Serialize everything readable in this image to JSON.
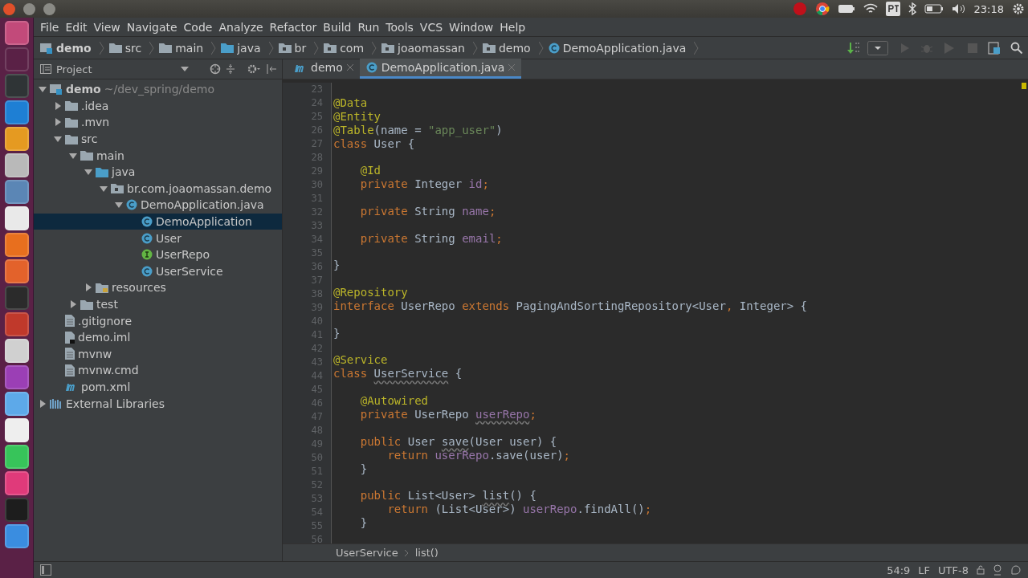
{
  "top_panel": {
    "clock": "23:18"
  },
  "menu": [
    "File",
    "Edit",
    "View",
    "Navigate",
    "Code",
    "Analyze",
    "Refactor",
    "Build",
    "Run",
    "Tools",
    "VCS",
    "Window",
    "Help"
  ],
  "nav_path": [
    {
      "label": "demo",
      "kind": "module"
    },
    {
      "label": "src",
      "kind": "folder"
    },
    {
      "label": "main",
      "kind": "folder"
    },
    {
      "label": "java",
      "kind": "source"
    },
    {
      "label": "br",
      "kind": "package"
    },
    {
      "label": "com",
      "kind": "package"
    },
    {
      "label": "joaomassan",
      "kind": "package"
    },
    {
      "label": "demo",
      "kind": "package"
    },
    {
      "label": "DemoApplication.java",
      "kind": "class"
    }
  ],
  "project_panel": {
    "title": "Project",
    "tree": [
      {
        "label": "demo",
        "hint": "~/dev_spring/demo",
        "kind": "module",
        "expanded": true,
        "selected": false,
        "children": [
          {
            "label": ".idea",
            "kind": "folder",
            "expanded": false,
            "selected": false
          },
          {
            "label": ".mvn",
            "kind": "folder",
            "expanded": false,
            "selected": false
          },
          {
            "label": "src",
            "kind": "folder",
            "expanded": true,
            "selected": false,
            "children": [
              {
                "label": "main",
                "kind": "folder",
                "expanded": true,
                "selected": false,
                "children": [
                  {
                    "label": "java",
                    "kind": "source",
                    "expanded": true,
                    "selected": false,
                    "children": [
                      {
                        "label": "br.com.joaomassan.demo",
                        "kind": "package",
                        "expanded": true,
                        "selected": false,
                        "children": [
                          {
                            "label": "DemoApplication.java",
                            "kind": "class",
                            "expanded": true,
                            "selected": false,
                            "children": [
                              {
                                "label": "DemoApplication",
                                "kind": "class",
                                "selected": true
                              },
                              {
                                "label": "User",
                                "kind": "class",
                                "selected": false
                              },
                              {
                                "label": "UserRepo",
                                "kind": "interface",
                                "selected": false
                              },
                              {
                                "label": "UserService",
                                "kind": "class",
                                "selected": false
                              }
                            ]
                          }
                        ]
                      }
                    ]
                  },
                  {
                    "label": "resources",
                    "kind": "resources",
                    "expanded": false,
                    "selected": false
                  }
                ]
              },
              {
                "label": "test",
                "kind": "folder",
                "expanded": false,
                "selected": false
              }
            ]
          },
          {
            "label": ".gitignore",
            "kind": "file",
            "selected": false
          },
          {
            "label": "demo.iml",
            "kind": "iml",
            "selected": false
          },
          {
            "label": "mvnw",
            "kind": "file",
            "selected": false
          },
          {
            "label": "mvnw.cmd",
            "kind": "file",
            "selected": false
          },
          {
            "label": "pom.xml",
            "kind": "maven",
            "selected": false
          }
        ]
      },
      {
        "label": "External Libraries",
        "kind": "libraries",
        "expanded": false,
        "selected": false
      }
    ]
  },
  "tabs": [
    {
      "label": "demo",
      "kind": "maven",
      "selected": false
    },
    {
      "label": "DemoApplication.java",
      "kind": "class",
      "selected": true
    }
  ],
  "code": [
    {
      "number": "23"
    },
    {
      "number": "24",
      "segments": [
        {
          "kind": "annotation",
          "text": "@Data"
        }
      ]
    },
    {
      "number": "25",
      "segments": [
        {
          "kind": "annotation",
          "text": "@Entity"
        }
      ]
    },
    {
      "number": "26",
      "segments": [
        {
          "kind": "annotation",
          "text": "@Table"
        },
        {
          "kind": "plain",
          "text": "(name = "
        },
        {
          "kind": "string",
          "text": "\"app_user\""
        },
        {
          "kind": "plain",
          "text": ")"
        }
      ]
    },
    {
      "number": "27",
      "segments": [
        {
          "kind": "keyword",
          "text": "class "
        },
        {
          "kind": "plain",
          "text": "User {"
        }
      ]
    },
    {
      "number": "28"
    },
    {
      "number": "29",
      "segments": [
        {
          "kind": "annotation",
          "text": "    @Id"
        }
      ]
    },
    {
      "number": "30",
      "segments": [
        {
          "kind": "keyword",
          "text": "    private "
        },
        {
          "kind": "plain",
          "text": "Integer "
        },
        {
          "kind": "field",
          "text": "id"
        },
        {
          "kind": "keyword",
          "text": ";"
        }
      ]
    },
    {
      "number": "31"
    },
    {
      "number": "32",
      "segments": [
        {
          "kind": "keyword",
          "text": "    private "
        },
        {
          "kind": "plain",
          "text": "String "
        },
        {
          "kind": "field",
          "text": "name"
        },
        {
          "kind": "keyword",
          "text": ";"
        }
      ]
    },
    {
      "number": "33"
    },
    {
      "number": "34",
      "segments": [
        {
          "kind": "keyword",
          "text": "    private "
        },
        {
          "kind": "plain",
          "text": "String "
        },
        {
          "kind": "field",
          "text": "email"
        },
        {
          "kind": "keyword",
          "text": ";"
        }
      ]
    },
    {
      "number": "35"
    },
    {
      "number": "36",
      "segments": [
        {
          "kind": "plain",
          "text": "}"
        }
      ]
    },
    {
      "number": "37"
    },
    {
      "number": "38",
      "segments": [
        {
          "kind": "annotation",
          "text": "@Repository"
        }
      ]
    },
    {
      "number": "39",
      "segments": [
        {
          "kind": "keyword",
          "text": "interface "
        },
        {
          "kind": "plain",
          "text": "UserRepo "
        },
        {
          "kind": "keyword",
          "text": "extends "
        },
        {
          "kind": "plain",
          "text": "PagingAndSortingRepository<User"
        },
        {
          "kind": "keyword",
          "text": ", "
        },
        {
          "kind": "plain",
          "text": "Integer> {"
        }
      ]
    },
    {
      "number": "40"
    },
    {
      "number": "41",
      "segments": [
        {
          "kind": "plain",
          "text": "}"
        }
      ]
    },
    {
      "number": "42"
    },
    {
      "number": "43",
      "segments": [
        {
          "kind": "annotation",
          "text": "@Service"
        }
      ]
    },
    {
      "number": "44",
      "segments": [
        {
          "kind": "keyword",
          "text": "class "
        },
        {
          "kind": "unused",
          "text": "UserService"
        },
        {
          "kind": "plain",
          "text": " {"
        }
      ]
    },
    {
      "number": "45"
    },
    {
      "number": "46",
      "segments": [
        {
          "kind": "annotation",
          "text": "    @Autowired"
        }
      ]
    },
    {
      "number": "47",
      "segments": [
        {
          "kind": "keyword",
          "text": "    private "
        },
        {
          "kind": "plain",
          "text": "UserRepo "
        },
        {
          "kind": "unused_field",
          "text": "userRepo"
        },
        {
          "kind": "keyword",
          "text": ";"
        }
      ]
    },
    {
      "number": "48"
    },
    {
      "number": "49",
      "segments": [
        {
          "kind": "keyword",
          "text": "    public "
        },
        {
          "kind": "plain",
          "text": "User "
        },
        {
          "kind": "unused",
          "text": "save"
        },
        {
          "kind": "plain",
          "text": "(User user) {"
        }
      ]
    },
    {
      "number": "50",
      "segments": [
        {
          "kind": "keyword",
          "text": "        return "
        },
        {
          "kind": "field",
          "text": "userRepo"
        },
        {
          "kind": "plain",
          "text": ".save(user)"
        },
        {
          "kind": "keyword",
          "text": ";"
        }
      ]
    },
    {
      "number": "51",
      "segments": [
        {
          "kind": "plain",
          "text": "    }"
        }
      ]
    },
    {
      "number": "52"
    },
    {
      "number": "53",
      "segments": [
        {
          "kind": "keyword",
          "text": "    public "
        },
        {
          "kind": "plain",
          "text": "List<User> "
        },
        {
          "kind": "unused",
          "text": "list"
        },
        {
          "kind": "plain",
          "text": "() {"
        }
      ]
    },
    {
      "number": "54",
      "segments": [
        {
          "kind": "keyword",
          "text": "        return "
        },
        {
          "kind": "plain",
          "text": "(List<User>) "
        },
        {
          "kind": "field",
          "text": "userRepo"
        },
        {
          "kind": "plain",
          "text": ".findAll()"
        },
        {
          "kind": "keyword",
          "text": ";"
        }
      ]
    },
    {
      "number": "55",
      "segments": [
        {
          "kind": "plain",
          "text": "    }"
        }
      ]
    },
    {
      "number": "56"
    }
  ],
  "editor_breadcrumb": [
    "UserService",
    "list()"
  ],
  "status_bar": {
    "position": "54:9",
    "line_separator": "LF",
    "encoding": "UTF-8"
  }
}
